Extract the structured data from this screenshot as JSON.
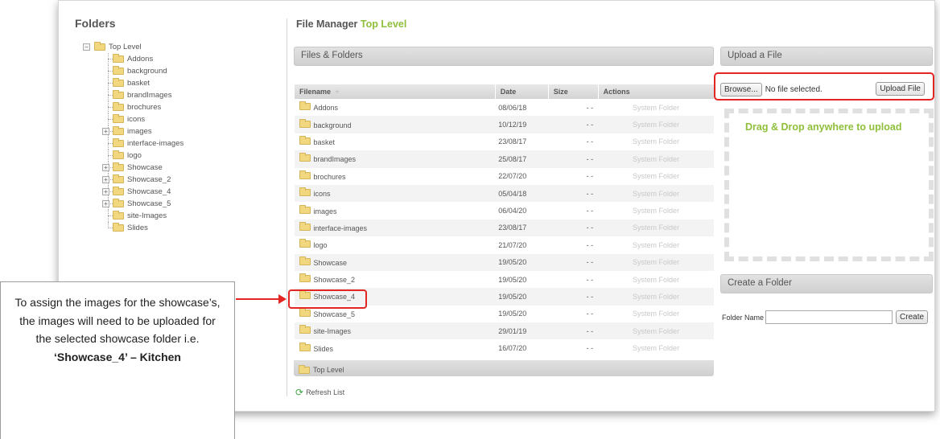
{
  "folders_panel": {
    "title": "Folders",
    "root": "Top Level",
    "items": [
      {
        "label": "Addons",
        "expandable": false
      },
      {
        "label": "background",
        "expandable": false
      },
      {
        "label": "basket",
        "expandable": false
      },
      {
        "label": "brandImages",
        "expandable": false
      },
      {
        "label": "brochures",
        "expandable": false
      },
      {
        "label": "icons",
        "expandable": false
      },
      {
        "label": "images",
        "expandable": true
      },
      {
        "label": "interface-images",
        "expandable": false
      },
      {
        "label": "logo",
        "expandable": false
      },
      {
        "label": "Showcase",
        "expandable": true
      },
      {
        "label": "Showcase_2",
        "expandable": true
      },
      {
        "label": "Showcase_4",
        "expandable": true
      },
      {
        "label": "Showcase_5",
        "expandable": true
      },
      {
        "label": "site-Images",
        "expandable": false
      },
      {
        "label": "Slides",
        "expandable": false
      }
    ]
  },
  "file_manager": {
    "title": "File Manager",
    "current_folder": "Top Level",
    "files_header": "Files & Folders",
    "columns": {
      "filename": "Filename",
      "sort_indicator": "÷",
      "date": "Date",
      "size": "Size",
      "actions": "Actions"
    },
    "rows": [
      {
        "name": "Addons",
        "date": "08/06/18",
        "size": "- -",
        "action": "System Folder"
      },
      {
        "name": "background",
        "date": "10/12/19",
        "size": "- -",
        "action": "System Folder"
      },
      {
        "name": "basket",
        "date": "23/08/17",
        "size": "- -",
        "action": "System Folder"
      },
      {
        "name": "brandImages",
        "date": "25/08/17",
        "size": "- -",
        "action": "System Folder"
      },
      {
        "name": "brochures",
        "date": "22/07/20",
        "size": "- -",
        "action": "System Folder"
      },
      {
        "name": "icons",
        "date": "05/04/18",
        "size": "- -",
        "action": "System Folder"
      },
      {
        "name": "images",
        "date": "06/04/20",
        "size": "- -",
        "action": "System Folder"
      },
      {
        "name": "interface-images",
        "date": "23/08/17",
        "size": "- -",
        "action": "System Folder"
      },
      {
        "name": "logo",
        "date": "21/07/20",
        "size": "- -",
        "action": "System Folder"
      },
      {
        "name": "Showcase",
        "date": "19/05/20",
        "size": "- -",
        "action": "System Folder"
      },
      {
        "name": "Showcase_2",
        "date": "19/05/20",
        "size": "- -",
        "action": "System Folder"
      },
      {
        "name": "Showcase_4",
        "date": "19/05/20",
        "size": "- -",
        "action": "System Folder"
      },
      {
        "name": "Showcase_5",
        "date": "19/05/20",
        "size": "- -",
        "action": "System Folder"
      },
      {
        "name": "site-Images",
        "date": "29/01/19",
        "size": "- -",
        "action": "System Folder"
      },
      {
        "name": "Slides",
        "date": "16/07/20",
        "size": "- -",
        "action": "System Folder"
      }
    ],
    "footer_folder": "Top Level",
    "refresh_label": "Refresh List"
  },
  "upload": {
    "header": "Upload a File",
    "browse_label": "Browse...",
    "file_status": "No file selected.",
    "upload_label": "Upload File",
    "drop_hint": "Drag & Drop anywhere to upload"
  },
  "create_folder": {
    "header": "Create a Folder",
    "field_label": "Folder Name",
    "field_value": "",
    "button_label": "Create"
  },
  "callout": {
    "text": "To assign the images for the showcase’s, the images will need to be uploaded for the selected showcase folder i.e.",
    "bold_text": "‘Showcase_4’ – Kitchen"
  },
  "colors": {
    "accent_green": "#8fbf3b",
    "highlight_red": "#e32624",
    "folder_yellow": "#f1d77f"
  }
}
